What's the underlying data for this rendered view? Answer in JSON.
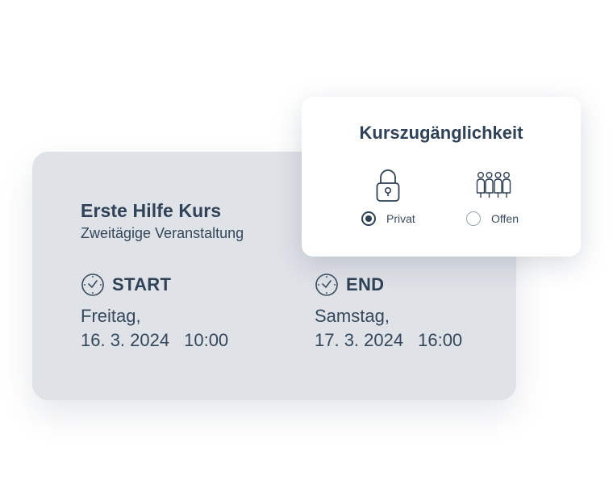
{
  "event": {
    "title": "Erste Hilfe Kurs",
    "subtitle": "Zweitägige Veranstaltung",
    "start": {
      "label": "START",
      "icon": "clock-icon",
      "day": "Freitag,",
      "date": "16. 3. 2024",
      "time": "10:00"
    },
    "end": {
      "label": "END",
      "icon": "clock-icon",
      "day": "Samstag,",
      "date": "17. 3. 2024",
      "time": "16:00"
    }
  },
  "accessibility": {
    "title": "Kurszugänglichkeit",
    "options": [
      {
        "label": "Privat",
        "icon": "lock-icon",
        "selected": true
      },
      {
        "label": "Offen",
        "icon": "group-icon",
        "selected": false
      }
    ]
  },
  "colors": {
    "text": "#2e4155",
    "card_background": "#dfe2e7",
    "popup_background": "#ffffff"
  }
}
